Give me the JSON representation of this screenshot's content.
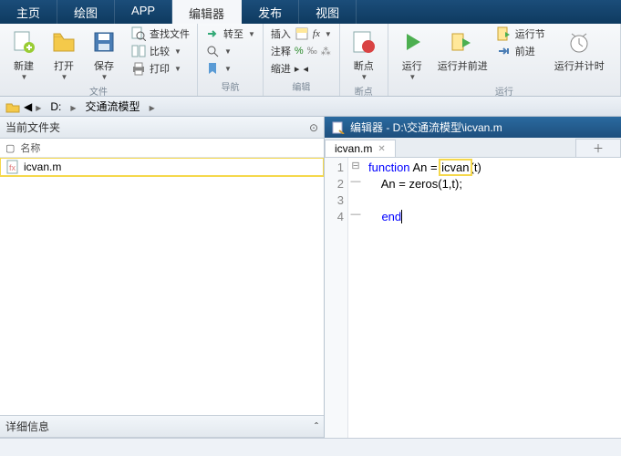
{
  "tabs": [
    "主页",
    "绘图",
    "APP",
    "编辑器",
    "发布",
    "视图"
  ],
  "active_tab_index": 3,
  "toolstrip": {
    "file": {
      "new": "新建",
      "open": "打开",
      "save": "保存",
      "findfiles": "查找文件",
      "compare": "比较",
      "print": "打印",
      "label": "文件"
    },
    "nav": {
      "goto": "转至",
      "label": "导航"
    },
    "edit": {
      "insert": "插入",
      "fx": "fx",
      "comment": "注释",
      "indent": "缩进",
      "label": "编辑"
    },
    "bp": {
      "breakpoints": "断点",
      "label": "断点"
    },
    "run": {
      "run": "运行",
      "advance": "运行并前进",
      "runsection": "运行节",
      "runstep": "前进",
      "runtime": "运行并计时",
      "label": "运行"
    }
  },
  "addrbar": {
    "root": "D:",
    "folder": "交通流模型"
  },
  "left": {
    "current_folder": "当前文件夹",
    "name_col": "名称",
    "files": [
      {
        "name": "icvan.m",
        "hl": true
      }
    ],
    "details": "详细信息"
  },
  "editor": {
    "title_prefix": "编辑器 - ",
    "path": "D:\\交通流模型\\icvan.m",
    "tab": "icvan.m",
    "lines": [
      {
        "n": "1",
        "mark": "",
        "html": "<span class='kw'>function</span> An = <span class='hl-box'>icvan</span>(t)"
      },
      {
        "n": "2",
        "mark": "—",
        "html": "An = zeros(1,t);"
      },
      {
        "n": "3",
        "mark": "",
        "html": ""
      },
      {
        "n": "4",
        "mark": "—",
        "html": "<span class='kw'>end</span><span class='cursor'></span>"
      }
    ]
  }
}
